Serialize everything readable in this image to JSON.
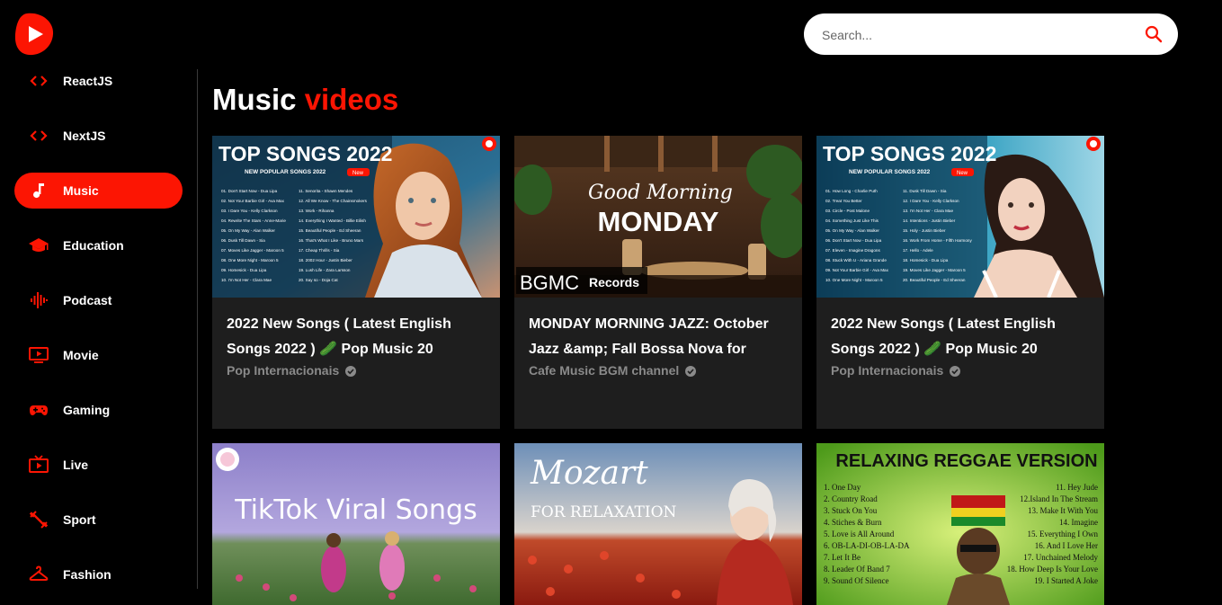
{
  "search": {
    "placeholder": "Search..."
  },
  "categories": [
    {
      "label": "ReactJS",
      "icon": "code-icon",
      "active": false
    },
    {
      "label": "NextJS",
      "icon": "code-icon",
      "active": false
    },
    {
      "label": "Music",
      "icon": "music-note-icon",
      "active": true
    },
    {
      "label": "Education",
      "icon": "graduation-cap-icon",
      "active": false
    },
    {
      "label": "Podcast",
      "icon": "soundwave-icon",
      "active": false
    },
    {
      "label": "Movie",
      "icon": "ondemand-video-icon",
      "active": false
    },
    {
      "label": "Gaming",
      "icon": "gamepad-icon",
      "active": false
    },
    {
      "label": "Live",
      "icon": "live-tv-icon",
      "active": false
    },
    {
      "label": "Sport",
      "icon": "fitness-icon",
      "active": false
    },
    {
      "label": "Fashion",
      "icon": "hanger-icon",
      "active": false
    }
  ],
  "feed": {
    "title_main": "Music",
    "title_accent": "videos",
    "videos": [
      {
        "title": "2022 New Songs ( Latest English Songs 2022 ) 🥒 Pop Music 20",
        "channel": "Pop Internacionais",
        "thumb": {
          "headline": "TOP SONGS 2022",
          "subline": "NEW POPULAR SONGS 2022",
          "badge": "New",
          "tracks_left": [
            "01. Don't Start Now - Dua Lipa",
            "02. Not Your Barbie Girl - Ava Max",
            "03. I Dare You - Kelly Clarkson",
            "04. Rewrite The Stars - Anne-Marie",
            "05. On My Way - Alan Walker",
            "06. Dusk Till Dawn - Sia",
            "07. Moves Like Jagger - Maroon 5",
            "08. One More Night - Maroon 5",
            "09. Homesick - Dua Lipa",
            "10. I'm Not Her - Clara Mae"
          ],
          "tracks_right": [
            "11. Senorita - Shawn Mendes",
            "12. All We Know - The Chainsmokers",
            "13. Work - Rihanna",
            "14. Everything I Wanted - Billie Eilish",
            "15. Beautiful People - Ed Sheeran",
            "16. That's What I Like - Bruno Mars",
            "17. Cheap Thrills - Sia",
            "18. 2002 Hour - Justin Bieber",
            "19. Lush Life - Zara Larsson",
            "20. Say so - Doja Cat"
          ]
        }
      },
      {
        "title": "MONDAY MORNING JAZZ: October Jazz &amp; Fall Bossa Nova for",
        "channel": "Cafe Music BGM channel",
        "thumb": {
          "script": "Good Morning",
          "headline": "MONDAY",
          "logo": "BGMC",
          "logo_text": "Records"
        }
      },
      {
        "title": "2022 New Songs ( Latest English Songs 2022 ) 🥒 Pop Music 20",
        "channel": "Pop Internacionais",
        "thumb": {
          "headline": "TOP SONGS 2022",
          "subline": "NEW POPULAR SONGS 2022",
          "badge": "New",
          "tracks_left": [
            "01. How Long - Charlie Puth",
            "02. Treat You Better",
            "03. Circle - Post Malone",
            "04. Something Just Like This",
            "05. On My Way - Alan Walker",
            "06. Don't Start Now - Dua Lipa",
            "07. Eleven - Imagine Dragons",
            "08. Stuck With U - Ariana Grande",
            "09. Not Your Barbie Girl - Ava Max",
            "10. One More Night - Maroon 5"
          ],
          "tracks_right": [
            "11. Dusk Till Dawn - Sia",
            "12. I Dare You - Kelly Clarkson",
            "13. I'm Not Her - Clara Mae",
            "14. Intentions - Justin Bieber",
            "15. Holy - Justin Bieber",
            "16. Work From Home - Fifth Harmony",
            "17. Hello - Adele",
            "18. Homesick - Dua Lipa",
            "19. Moves Like Jagger - Maroon 5",
            "20. Beautiful People - Ed Sheeran"
          ]
        }
      },
      {
        "title": "",
        "channel": "",
        "thumb": {
          "headline": "TikTok Viral Songs"
        }
      },
      {
        "title": "",
        "channel": "",
        "thumb": {
          "headline": "Mozart",
          "subline": "FOR RELAXATION"
        }
      },
      {
        "title": "",
        "channel": "",
        "thumb": {
          "headline": "RELAXING REGGAE VERSION",
          "tracks_left": [
            "1. One Day",
            "2. Country Road",
            "3. Stuck On You",
            "4. Stiches & Burn",
            "5. Love is All Around",
            "6. OB-LA-DI-OB-LA-DA",
            "7. Let It Be",
            "8. Leader Of Band 7",
            "9. Sound Of Silence"
          ],
          "tracks_right": [
            "11. Hey Jude",
            "12.Island In The Stream",
            "13. Make It With You",
            "14. Imagine",
            "15. Everything I Own",
            "16. And I Love Her",
            "17. Unchained Melody",
            "18. How Deep Is Your Love",
            "19. I Started A Joke"
          ]
        }
      }
    ]
  }
}
